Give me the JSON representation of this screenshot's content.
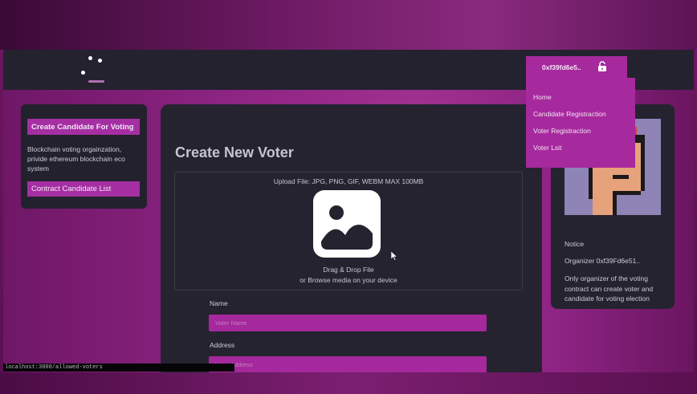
{
  "navbar": {
    "logo_icon": "logo-icon"
  },
  "wallet": {
    "address": "0xf39fd6e5..",
    "icon": "unlock-icon"
  },
  "menu": {
    "items": [
      {
        "label": "Home"
      },
      {
        "label": "Candidate Registraction"
      },
      {
        "label": "Voter Registraction"
      },
      {
        "label": "Voter Lsit"
      }
    ]
  },
  "left_panel": {
    "create_candidate_label": "Create Candidate For Voting",
    "description": "Blockchain voting orgainzation, privide ethereum blockchain eco system",
    "contract_list_label": "Contract Candidate List"
  },
  "main": {
    "title": "Create New Voter",
    "upload": {
      "file_types": "Upload File: JPG, PNG, GIF, WEBM MAX 100MB",
      "drag_text": "Drag & Drop File",
      "browse_text": "or Browse media on your device",
      "icon": "image-icon"
    },
    "fields": {
      "name_label": "Name",
      "name_placeholder": "Voter Name",
      "address_label": "Address",
      "address_placeholder": "Voter Address"
    }
  },
  "notice": {
    "title": "Notice",
    "organizer": "Organizer 0xf39Fd6e51..",
    "text": "Only organizer of the voting contract can create voter and candidate for voting election"
  },
  "status_bar": {
    "url": "localhost:3000/allowed-voters"
  },
  "colors": {
    "accent": "#a7299e",
    "card_bg": "#25232f",
    "navbar_bg": "#24222f"
  }
}
